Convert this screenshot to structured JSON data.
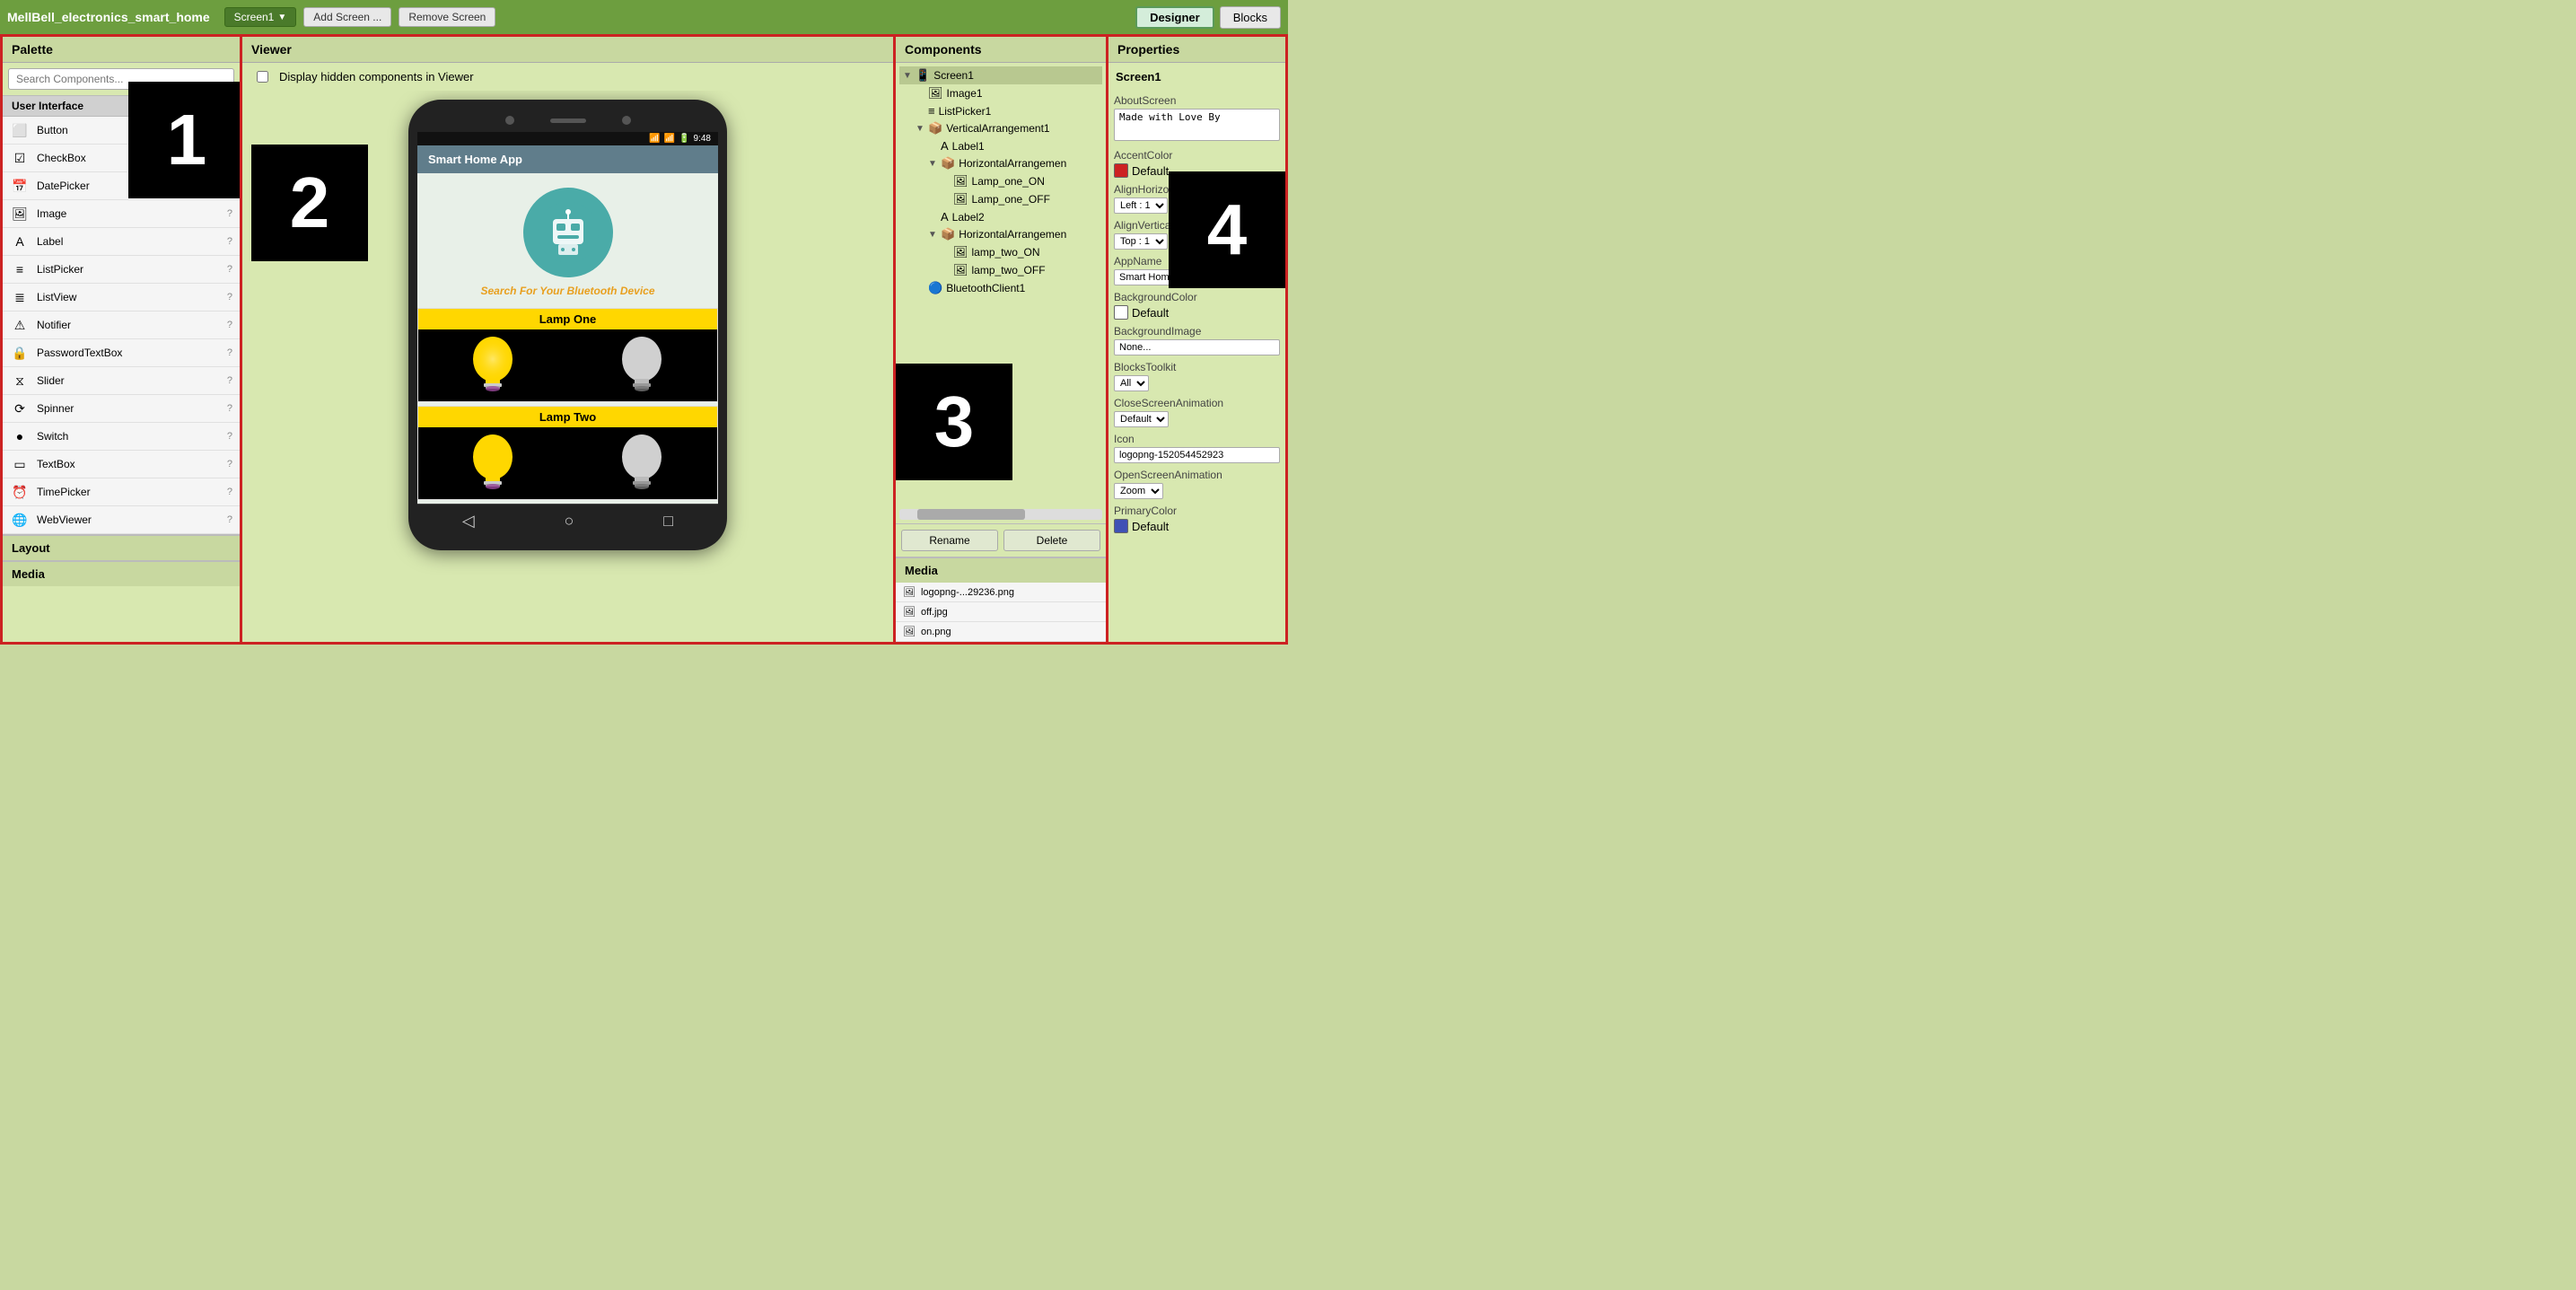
{
  "topbar": {
    "project_name": "MellBell_electronics_smart_home",
    "screen_btn": "Screen1",
    "add_screen": "Add Screen ...",
    "remove_screen": "Remove Screen",
    "designer_btn": "Designer",
    "blocks_btn": "Blocks"
  },
  "palette": {
    "title": "Palette",
    "search_placeholder": "Search Components...",
    "section_ui": "User Interface",
    "components": [
      {
        "name": "Button",
        "icon": "⬜"
      },
      {
        "name": "CheckBox",
        "icon": "☑"
      },
      {
        "name": "DatePicker",
        "icon": "📅"
      },
      {
        "name": "Image",
        "icon": "🖼"
      },
      {
        "name": "Label",
        "icon": "A"
      },
      {
        "name": "ListPicker",
        "icon": "≡"
      },
      {
        "name": "ListView",
        "icon": "≣"
      },
      {
        "name": "Notifier",
        "icon": "⚠"
      },
      {
        "name": "PasswordTextBox",
        "icon": "🔒"
      },
      {
        "name": "Slider",
        "icon": "⧖"
      },
      {
        "name": "Spinner",
        "icon": "⟳"
      },
      {
        "name": "Switch",
        "icon": "●"
      },
      {
        "name": "TextBox",
        "icon": "▭"
      },
      {
        "name": "TimePicker",
        "icon": "⏰"
      },
      {
        "name": "WebViewer",
        "icon": "🌐"
      }
    ],
    "section_layout": "Layout",
    "section_media": "Media"
  },
  "viewer": {
    "title": "Viewer",
    "hidden_label": "Display hidden components in Viewer",
    "phone": {
      "time": "9:48",
      "app_name": "Smart Home App",
      "search_text": "Search For Your Bluetooth Device",
      "lamp_one_label": "Lamp One",
      "lamp_two_label": "Lamp Two"
    }
  },
  "components": {
    "title": "Components",
    "tree": [
      {
        "level": 0,
        "name": "Screen1",
        "icon": "📱",
        "expanded": true,
        "selected": true
      },
      {
        "level": 1,
        "name": "Image1",
        "icon": "🖼"
      },
      {
        "level": 1,
        "name": "ListPicker1",
        "icon": "≡"
      },
      {
        "level": 1,
        "name": "VerticalArrangement1",
        "icon": "📦",
        "expanded": true
      },
      {
        "level": 2,
        "name": "Label1",
        "icon": "A"
      },
      {
        "level": 2,
        "name": "HorizontalArrangemen",
        "icon": "📦",
        "expanded": true
      },
      {
        "level": 3,
        "name": "Lamp_one_ON",
        "icon": "🖼"
      },
      {
        "level": 3,
        "name": "Lamp_one_OFF",
        "icon": "🖼"
      },
      {
        "level": 2,
        "name": "Label2",
        "icon": "A"
      },
      {
        "level": 2,
        "name": "HorizontalArrangemen",
        "icon": "📦",
        "expanded": true
      },
      {
        "level": 3,
        "name": "lamp_two_ON",
        "icon": "🖼"
      },
      {
        "level": 3,
        "name": "lamp_two_OFF",
        "icon": "🖼"
      },
      {
        "level": 1,
        "name": "BluetoothClient1",
        "icon": "🔵"
      }
    ],
    "rename_btn": "Rename",
    "delete_btn": "Delete",
    "media_title": "Media",
    "media_items": [
      {
        "name": "logopng-...29236.png",
        "icon": "🖼"
      },
      {
        "name": "off.jpg",
        "icon": "🖼"
      },
      {
        "name": "on.png",
        "icon": "🖼"
      }
    ]
  },
  "properties": {
    "title": "Properties",
    "screen_name": "Screen1",
    "props": [
      {
        "label": "AboutScreen",
        "type": "textarea",
        "value": "Made with Love By"
      },
      {
        "label": "AccentColor",
        "type": "color",
        "color": "#cc2222",
        "value": "Default"
      },
      {
        "label": "AlignHorizontal",
        "type": "select",
        "value": "Left : 1"
      },
      {
        "label": "AlignVertical",
        "type": "select",
        "value": "Top : 1"
      },
      {
        "label": "AppName",
        "type": "input",
        "value": "Smart Home"
      },
      {
        "label": "BackgroundColor",
        "type": "color",
        "color": "#ffffff",
        "value": "Default"
      },
      {
        "label": "BackgroundImage",
        "type": "input",
        "value": "None..."
      },
      {
        "label": "BlocksToolkit",
        "type": "select",
        "value": "All"
      },
      {
        "label": "CloseScreenAnimation",
        "type": "select",
        "value": "Default"
      },
      {
        "label": "Icon",
        "type": "input",
        "value": "logopng-152054452923"
      },
      {
        "label": "OpenScreenAnimation",
        "type": "select",
        "value": "Zoom"
      },
      {
        "label": "PrimaryColor",
        "type": "color",
        "color": "#3f51b5",
        "value": "Default"
      }
    ]
  },
  "overlays": {
    "num1": "1",
    "num2": "2",
    "num3": "3",
    "num4": "4"
  }
}
